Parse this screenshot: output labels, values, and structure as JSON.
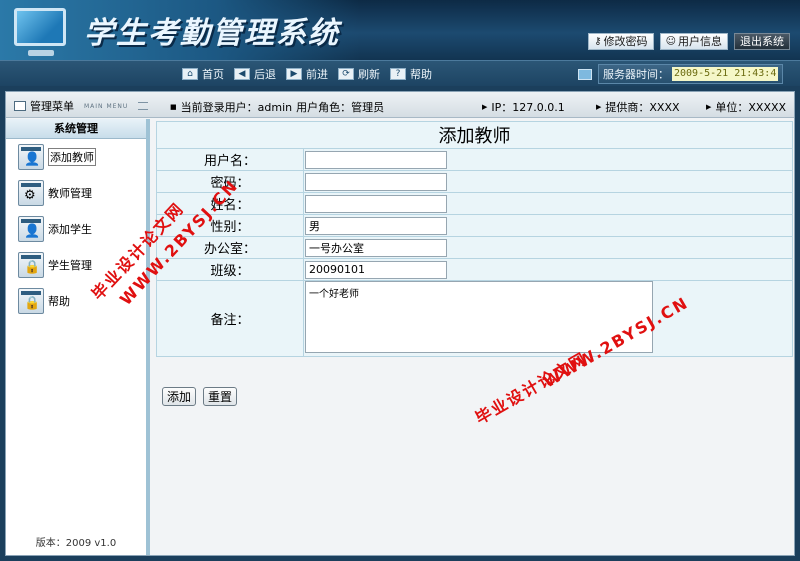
{
  "app": {
    "title": "学生考勤管理系统",
    "top_buttons": [
      {
        "label": "修改密码",
        "icon": "key-icon"
      },
      {
        "label": "用户信息",
        "icon": "user-icon"
      },
      {
        "label": "退出系统",
        "icon": ""
      }
    ]
  },
  "toolbar": {
    "nav": [
      {
        "label": "首页",
        "icon": "home-icon",
        "glyph": "⌂"
      },
      {
        "label": "后退",
        "icon": "back-arrow-icon",
        "glyph": "◀"
      },
      {
        "label": "前进",
        "icon": "forward-arrow-icon",
        "glyph": "▶"
      },
      {
        "label": "刷新",
        "icon": "refresh-icon",
        "glyph": "⟳"
      },
      {
        "label": "帮助",
        "icon": "help-icon",
        "glyph": "?"
      }
    ],
    "server_label": "服务器时间：",
    "server_time": "2009-5-21 21:43:4"
  },
  "subbar": {
    "menu_title": "管理菜单",
    "menu_en": "MAIN MENU",
    "login_user_label": "当前登录用户：admin",
    "user_role_label": "用户角色：管理员",
    "ip_label": "IP：127.0.0.1",
    "provider_label": "提供商：XXXX",
    "unit_label": "单位：XXXXX"
  },
  "sidebar": {
    "heading": "系统管理",
    "items": [
      {
        "label": "添加教师",
        "icon": "add-teacher-icon",
        "glyph": "👤",
        "selected": true
      },
      {
        "label": "教师管理",
        "icon": "teacher-manage-icon",
        "glyph": "⚙",
        "selected": false
      },
      {
        "label": "添加学生",
        "icon": "add-student-icon",
        "glyph": "👤",
        "selected": false
      },
      {
        "label": "学生管理",
        "icon": "student-manage-icon",
        "glyph": "🔒",
        "selected": false
      },
      {
        "label": "帮助",
        "icon": "help-icon",
        "glyph": "🔒",
        "selected": false
      }
    ],
    "version": "版本：2009 v1.0"
  },
  "form": {
    "title": "添加教师",
    "fields": [
      {
        "label": "用户名：",
        "value": "",
        "name": "username-field"
      },
      {
        "label": "密码：",
        "value": "",
        "name": "password-field"
      },
      {
        "label": "姓名：",
        "value": "",
        "name": "name-field"
      },
      {
        "label": "性别：",
        "value": "男",
        "name": "gender-field"
      },
      {
        "label": "办公室：",
        "value": "一号办公室",
        "name": "office-field"
      },
      {
        "label": "班级：",
        "value": "20090101",
        "name": "class-field"
      }
    ],
    "memo_label": "备注：",
    "memo_value": "一个好老师",
    "add_button": "添加",
    "reset_button": "重置"
  },
  "watermarks": {
    "text_cn": "毕业设计论文网",
    "text_url": "WWW.2BYSJ.CN"
  }
}
